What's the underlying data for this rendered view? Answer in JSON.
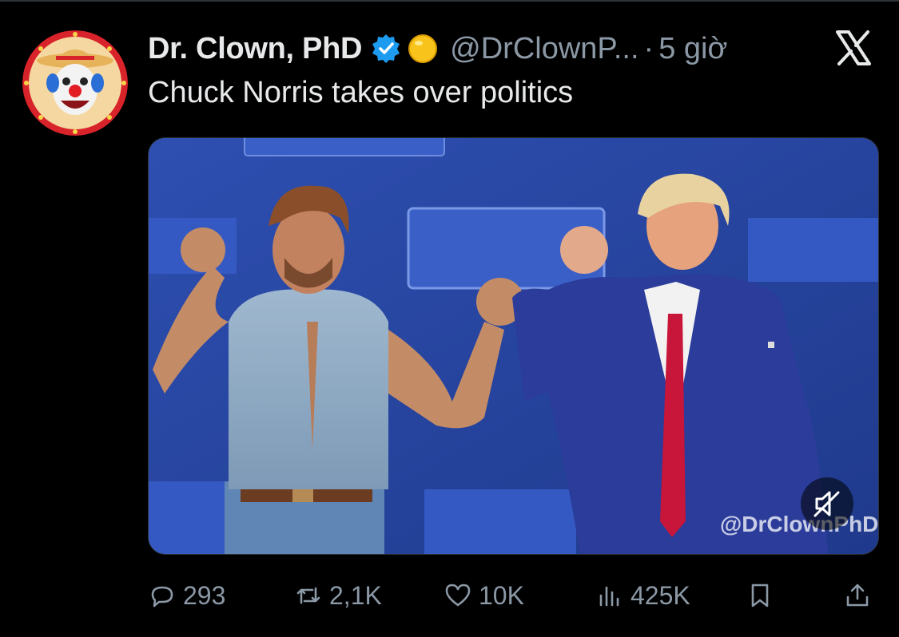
{
  "author": {
    "display_name": "Dr. Clown, PhD",
    "handle": "@DrClownP...",
    "separator": "·",
    "time": "5 giờ",
    "verified_icon": "verified-badge-icon",
    "status_emoji": "yellow-circle-emoji"
  },
  "tweet": {
    "text": "Chuck Norris takes over politics"
  },
  "media": {
    "watermark": "@DrClownPhD",
    "mute_icon": "muted-speaker-icon"
  },
  "actions": {
    "replies": "293",
    "reposts": "2,1K",
    "likes": "10K",
    "views": "425K"
  },
  "colors": {
    "background": "#000000",
    "text_primary": "#e7e9ea",
    "text_secondary": "#8b98a5",
    "verified": "#1d9bf0"
  }
}
